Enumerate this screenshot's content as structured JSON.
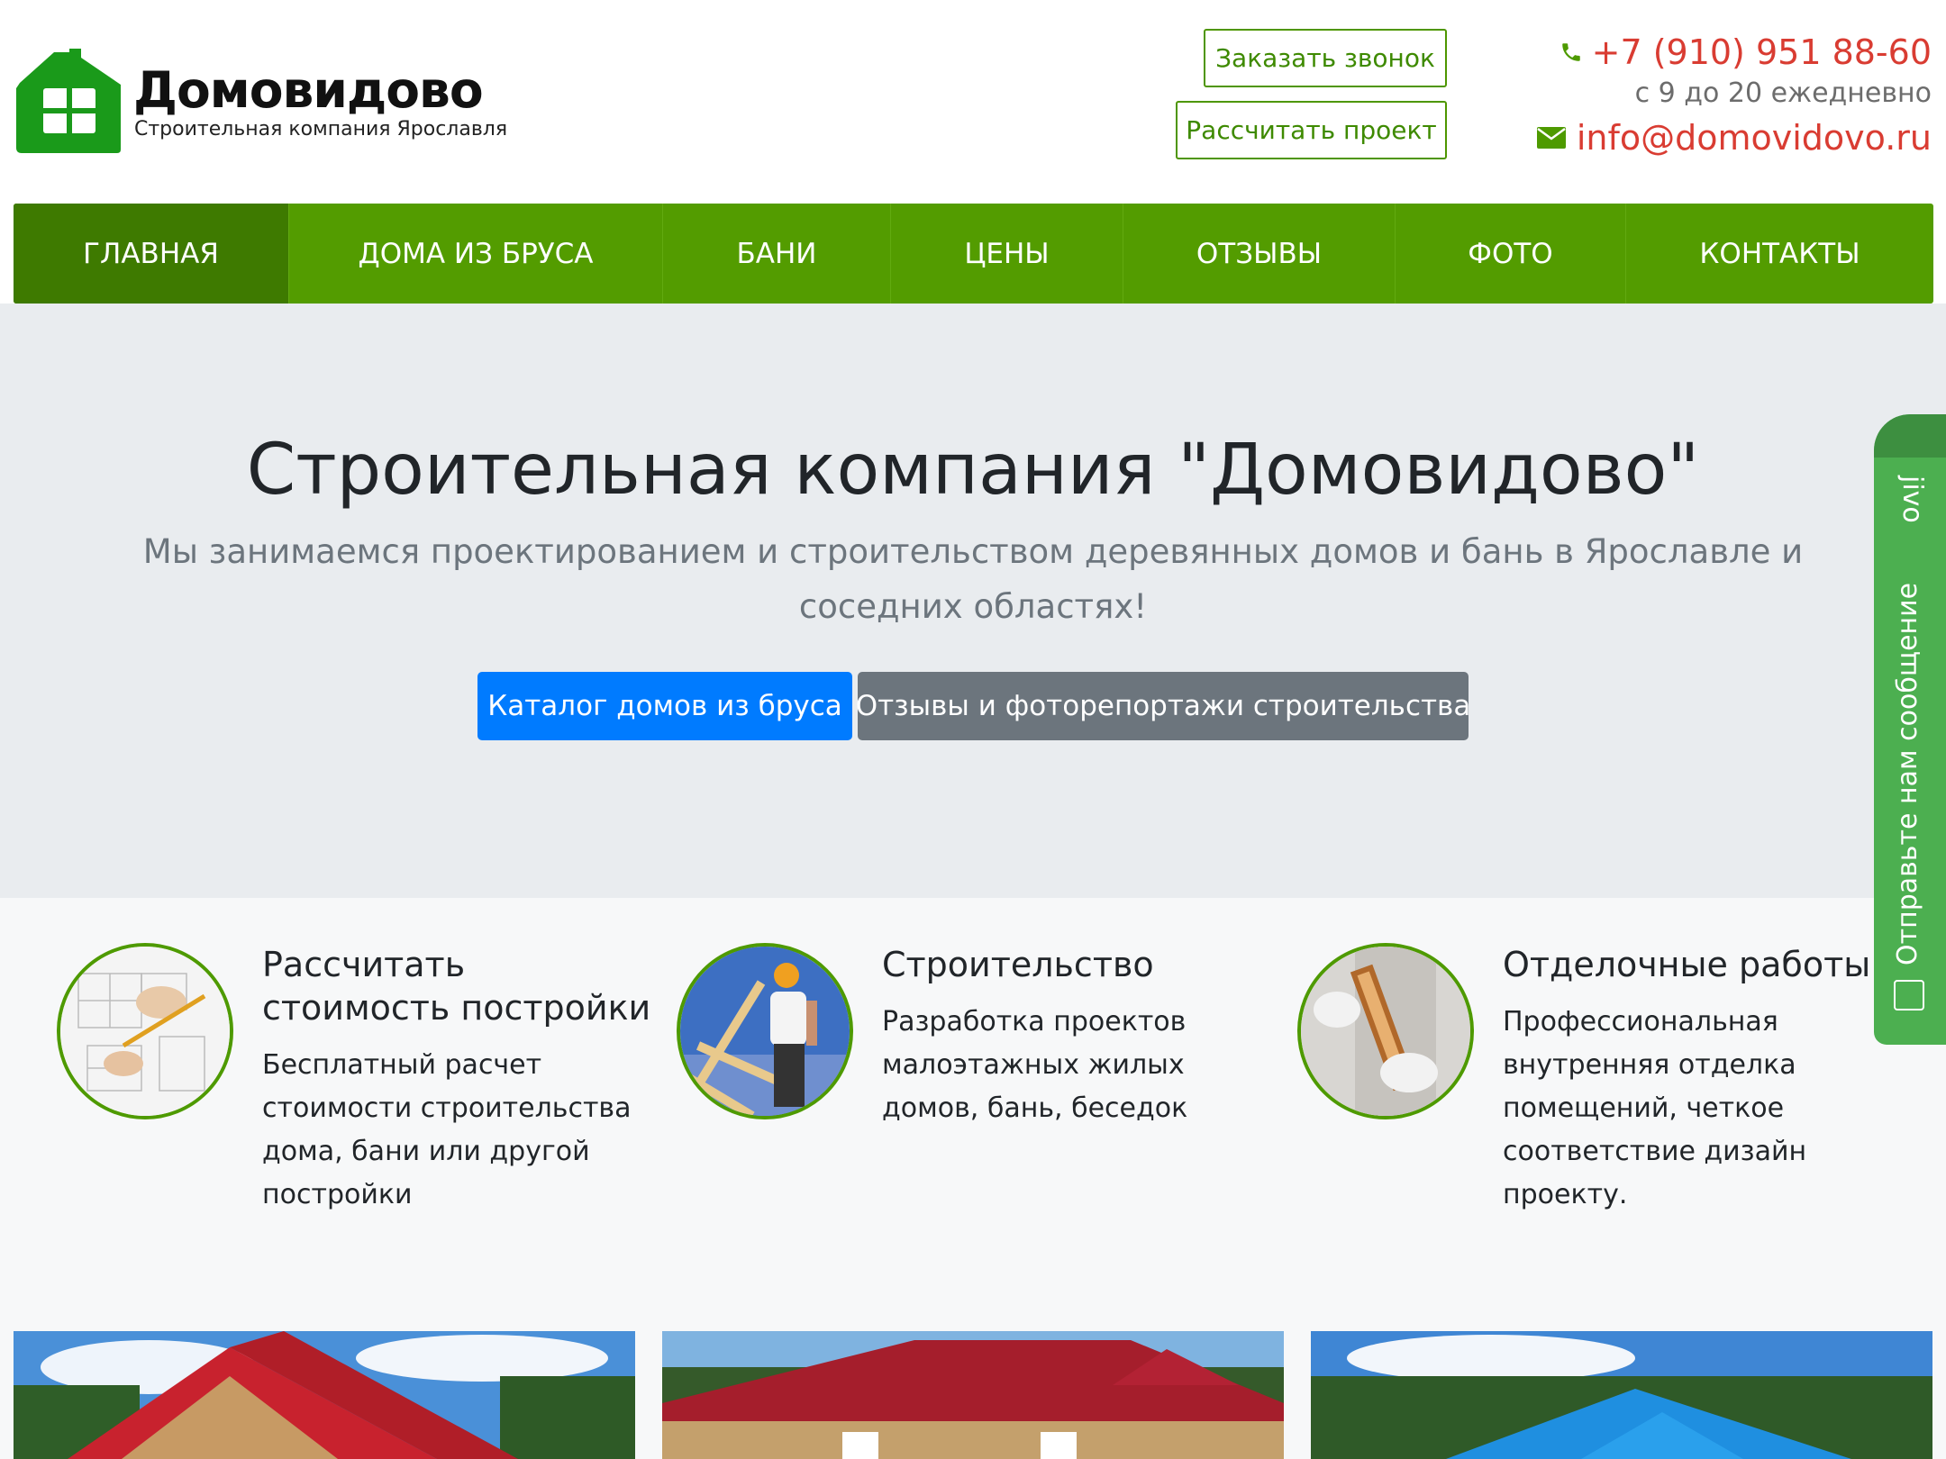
{
  "brand": {
    "name": "Домовидово",
    "tagline": "Строительная компания Ярославля",
    "color_green": "#539c00",
    "color_logo": "#1a9a1a"
  },
  "header": {
    "call_button": "Заказать звонок",
    "calc_button": "Рассчитать проект",
    "phone": "+7 (910) 951 88-60",
    "hours": "с 9 до 20 ежедневно",
    "email": "info@domovidovo.ru",
    "phone_icon": "phone-icon",
    "mail_icon": "envelope-icon"
  },
  "nav": {
    "items": [
      {
        "label": "ГЛАВНАЯ"
      },
      {
        "label": "ДОМА ИЗ БРУСА"
      },
      {
        "label": "БАНИ"
      },
      {
        "label": "ЦЕНЫ"
      },
      {
        "label": "ОТЗЫВЫ"
      },
      {
        "label": "ФОТО"
      },
      {
        "label": "КОНТАКТЫ"
      }
    ]
  },
  "hero": {
    "title": "Строительная компания \"Домовидово\"",
    "lead": "Мы занимаемся проектированием и строительством деревянных домов и бань в Ярославле и соседних областях!",
    "primary_button": "Каталог домов из бруса",
    "secondary_button": "Отзывы и фоторепортажи строительства"
  },
  "features": [
    {
      "title": "Рассчитать стоимость постройки",
      "text": "Бесплатный расчет стоимости строительства дома, бани или другой постройки"
    },
    {
      "title": "Строительство",
      "text": "Разработка проектов малоэтажных жилых домов, бань, беседок"
    },
    {
      "title": "Отделочные работы",
      "text": "Профессиональная внутренняя отделка помещений, четкое соответствие дизайн проекту."
    }
  ],
  "jivo": {
    "logo": "jivo",
    "label": "Отправьте нам сообщение"
  }
}
